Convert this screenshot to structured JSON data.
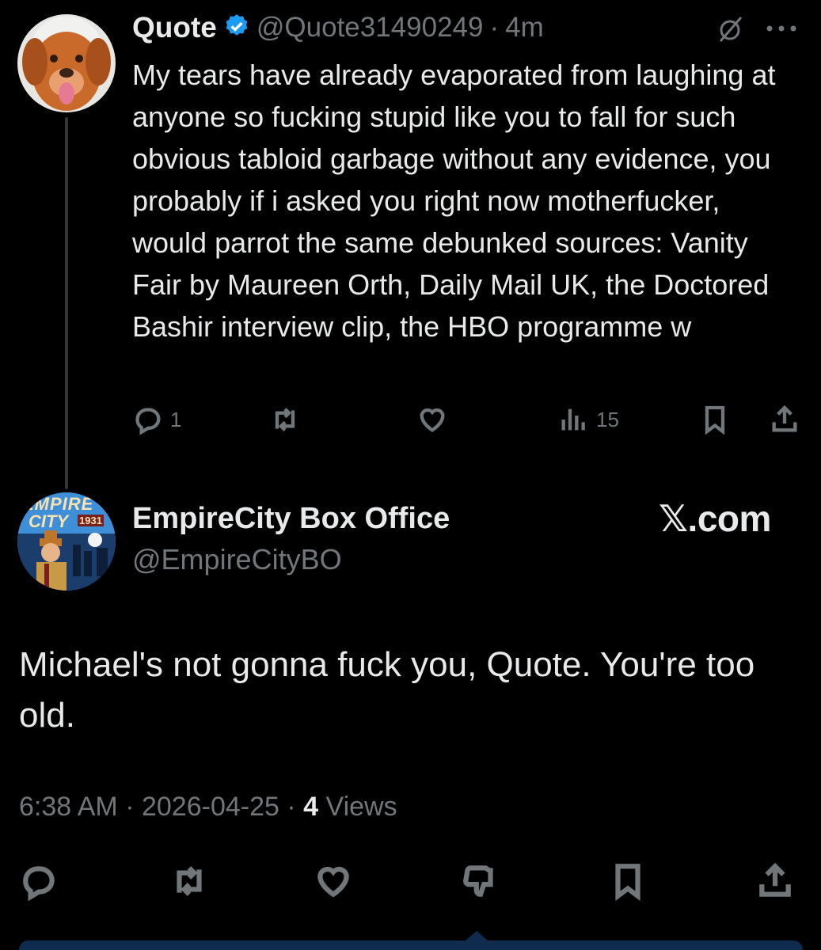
{
  "reply_tweet": {
    "author_name": "Quote",
    "handle": "@Quote31490249",
    "separator": "·",
    "time_ago": "4m",
    "text": "My tears have already evaporated from laughing at anyone so fucking stupid like you to fall for such obvious tabloid garbage without any evidence, you probably if i asked you right now motherfucker, would parrot the same debunked sources: Vanity Fair by Maureen Orth, Daily Mail UK, the Doctored Bashir interview clip, the HBO programme w",
    "verified_icon": "verified-badge-icon",
    "actions": {
      "reply_count": "1",
      "views_count": "15"
    }
  },
  "main_tweet": {
    "author_name": "EmpireCity Box Office",
    "handle": "@EmpireCityBO",
    "avatar_text_top": "EMPIRE",
    "avatar_text_mid": "CITY",
    "avatar_year": "1931",
    "watermark": "𝕏.com",
    "text": "Michael's not gonna fuck you, Quote.  You're too old.",
    "time": "6:38 AM",
    "date": "2026-04-25",
    "separator": "·",
    "views_count": "4",
    "views_label": "Views"
  },
  "colors": {
    "background": "#000000",
    "text": "#e7e9ea",
    "muted": "#71767b",
    "verified": "#1d9bf0"
  }
}
